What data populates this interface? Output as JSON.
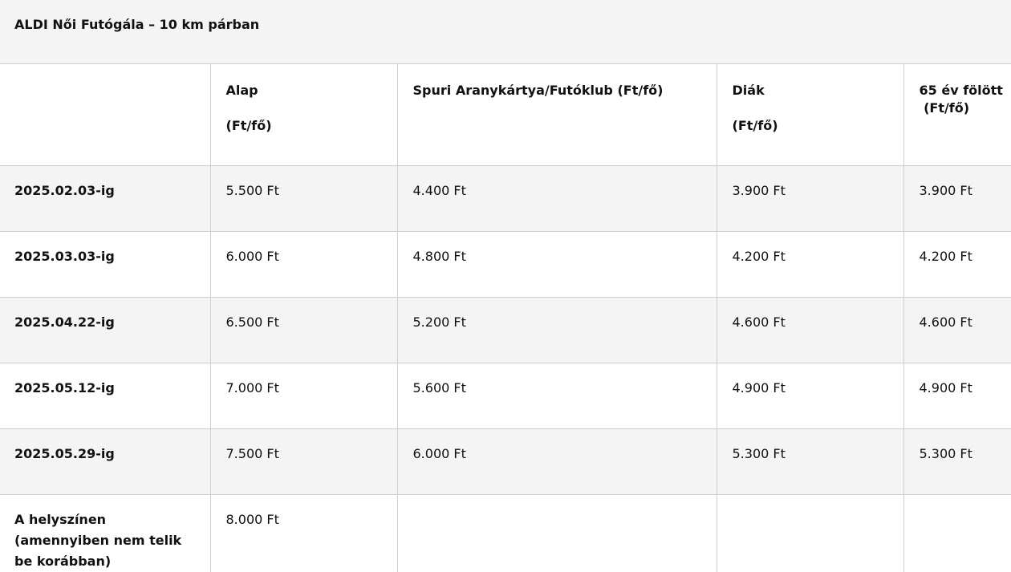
{
  "title": "ALDI Női Futógála – 10 km párban",
  "table": {
    "headers": [
      {
        "line1": "",
        "line2": ""
      },
      {
        "line1": "Alap",
        "line2": "(Ft/fő)"
      },
      {
        "line1": "Spuri Aranykártya/Futóklub (Ft/fő)",
        "line2": ""
      },
      {
        "line1": "Diák",
        "line2": "(Ft/fő)"
      },
      {
        "line1": "65 év fölött",
        "line2": " (Ft/fő)"
      }
    ],
    "rows": [
      {
        "date": "2025.02.03-ig",
        "alap": "5.500 Ft",
        "spuri": "4.400 Ft",
        "diak": "3.900 Ft",
        "senior": "3.900 Ft"
      },
      {
        "date": "2025.03.03-ig",
        "alap": "6.000 Ft",
        "spuri": "4.800 Ft",
        "diak": "4.200 Ft",
        "senior": "4.200 Ft"
      },
      {
        "date": "2025.04.22-ig",
        "alap": "6.500 Ft",
        "spuri": "5.200 Ft",
        "diak": "4.600 Ft",
        "senior": "4.600 Ft"
      },
      {
        "date": "2025.05.12-ig",
        "alap": "7.000 Ft",
        "spuri": "5.600 Ft",
        "diak": "4.900 Ft",
        "senior": "4.900 Ft"
      },
      {
        "date": "2025.05.29-ig",
        "alap": "7.500 Ft",
        "spuri": "6.000 Ft",
        "diak": "5.300 Ft",
        "senior": "5.300 Ft"
      },
      {
        "date": "A helyszínen (amennyiben nem telik be korábban)",
        "alap": "8.000 Ft",
        "spuri": "",
        "diak": "",
        "senior": ""
      }
    ]
  }
}
